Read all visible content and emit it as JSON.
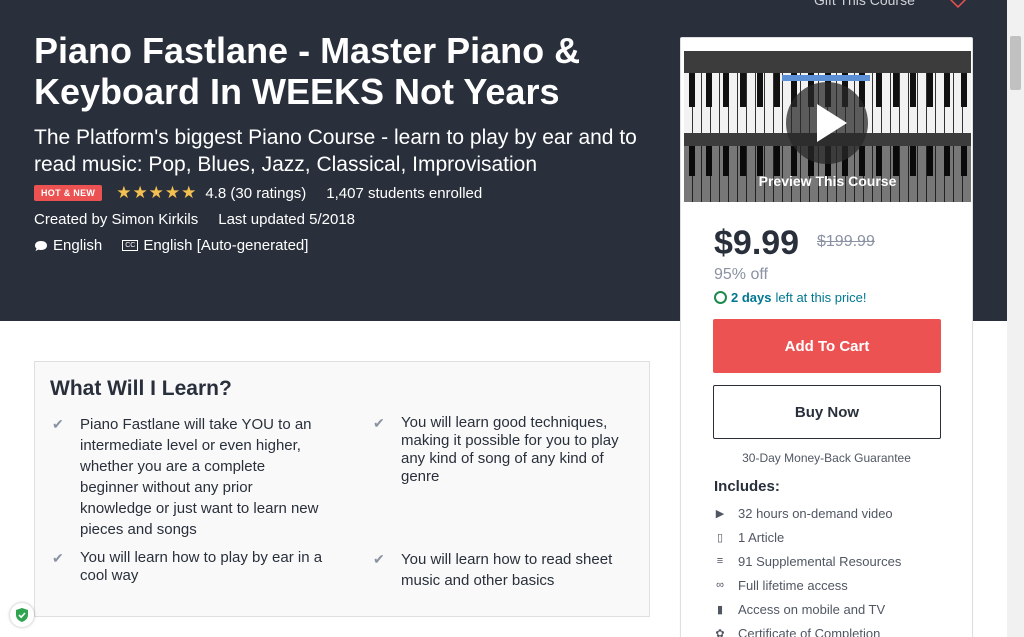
{
  "top": {
    "gift_label": "Gift This Course"
  },
  "course": {
    "title": "Piano Fastlane - Master Piano & Keyboard In WEEKS Not Years",
    "subtitle": "The Platform's biggest Piano Course - learn to play by ear and to read music: Pop, Blues, Jazz, Classical, Improvisation",
    "badge": "HOT & NEW",
    "stars": "★★★★★",
    "rating_text": "4.8 (30 ratings)",
    "enrolled_text": "1,407 students enrolled",
    "created_by": "Created by Simon Kirkils",
    "last_updated": "Last updated 5/2018",
    "language": "English",
    "captions_icon": "CC",
    "captions": "English [Auto-generated]"
  },
  "sidebar": {
    "preview_label": "Preview This Course",
    "price": "$9.99",
    "original_price": "$199.99",
    "discount": "95% off",
    "timer_days": "2 days",
    "timer_rest": "left at this price!",
    "add_to_cart": "Add To Cart",
    "buy_now": "Buy Now",
    "guarantee": "30-Day Money-Back Guarantee",
    "includes_title": "Includes:",
    "includes": [
      {
        "icon": "video-icon",
        "glyph": "▶",
        "label": "32 hours on-demand video"
      },
      {
        "icon": "file-icon",
        "glyph": "▯",
        "label": "1 Article"
      },
      {
        "icon": "document-icon",
        "glyph": "≡",
        "label": "91 Supplemental Resources"
      },
      {
        "icon": "infinity-icon",
        "glyph": "∞",
        "label": "Full lifetime access"
      },
      {
        "icon": "mobile-icon",
        "glyph": "▮",
        "label": "Access on mobile and TV"
      },
      {
        "icon": "certificate-icon",
        "glyph": "✿",
        "label": "Certificate of Completion"
      }
    ]
  },
  "learn": {
    "title": "What Will I Learn?",
    "items": [
      "Piano Fastlane will take YOU to an intermediate level or even higher, whether you are a complete beginner without any prior knowledge or just want to learn new pieces and songs",
      "You will learn good techniques, making it possible for you to play any kind of song of any kind of genre",
      "You will learn how to play by ear in a cool way",
      "You will learn how to read sheet music and other basics"
    ]
  },
  "colors": {
    "hero_bg": "#29303b",
    "accent": "#ec5252",
    "star": "#f4c150",
    "timer": "#1e8a4e"
  }
}
